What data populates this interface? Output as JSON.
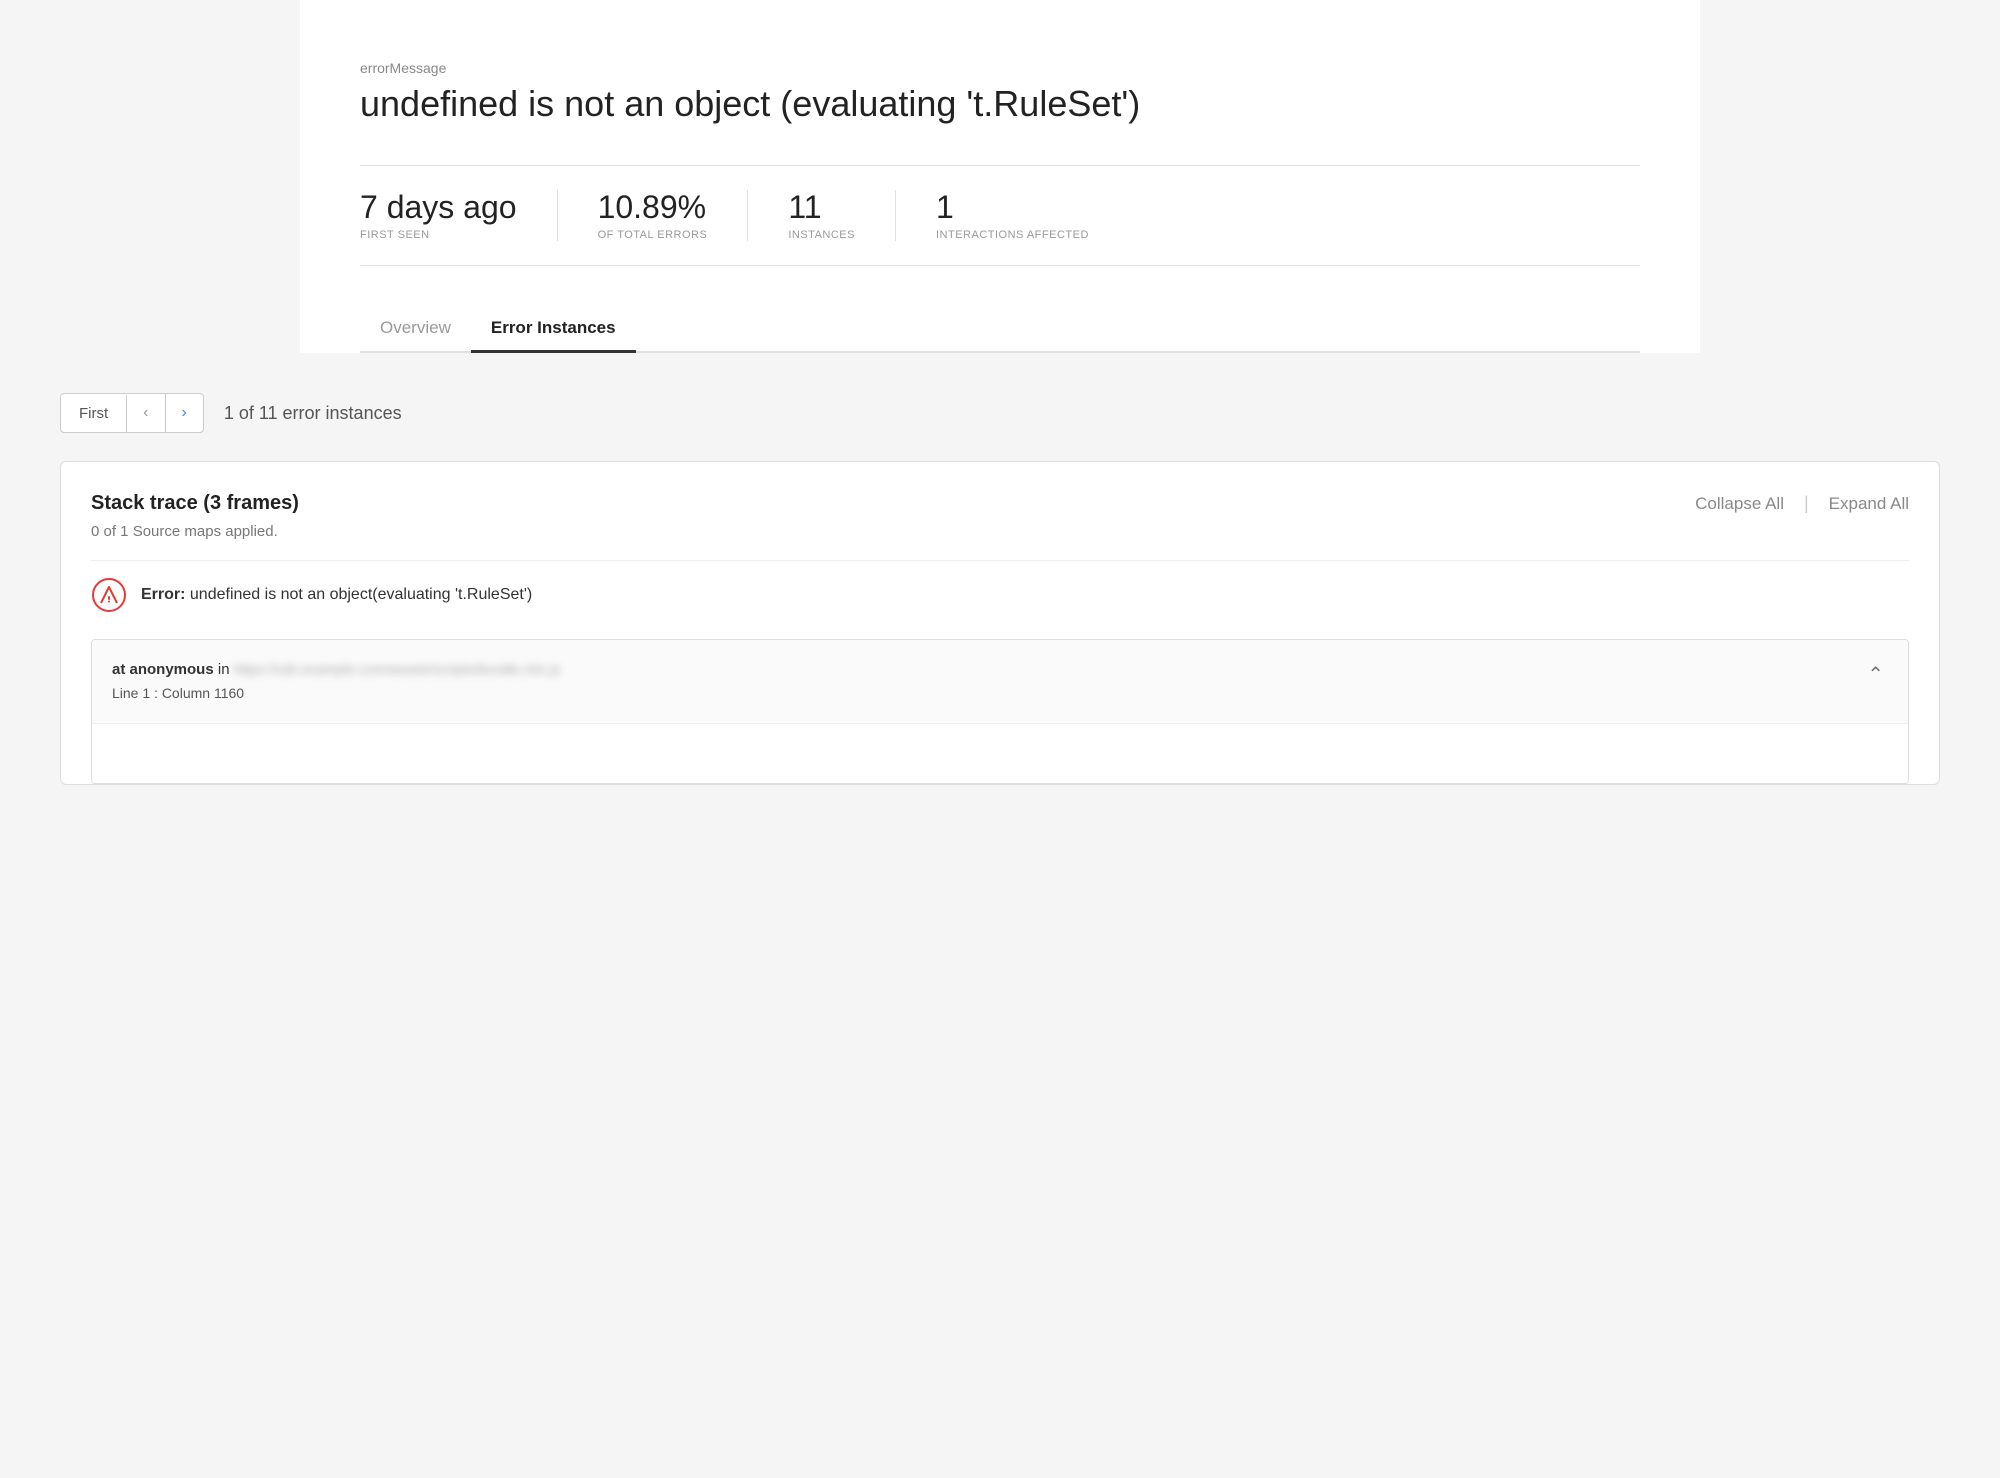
{
  "header": {
    "error_label": "errorMessage",
    "error_title": "undefined is not an object (evaluating 't.RuleSet')"
  },
  "stats": [
    {
      "value": "7 days ago",
      "label": "FIRST SEEN"
    },
    {
      "value": "10.89%",
      "label": "OF TOTAL ERRORS"
    },
    {
      "value": "11",
      "label": "INSTANCES"
    },
    {
      "value": "1",
      "label": "INTERACTIONS AFFECTED"
    }
  ],
  "tabs": [
    {
      "label": "Overview",
      "active": false
    },
    {
      "label": "Error Instances",
      "active": true
    }
  ],
  "instance_nav": {
    "first_label": "First",
    "prev_label": "‹",
    "next_label": "›",
    "count_text": "1 of 11 error instances"
  },
  "stack_trace": {
    "title": "Stack trace (3 frames)",
    "collapse_label": "Collapse All",
    "expand_label": "Expand All",
    "divider": "|",
    "source_maps": "0 of 1 Source maps applied.",
    "error_text_prefix": "Error:",
    "error_text_body": " undefined is not an object(evaluating 't.RuleSet')",
    "frame": {
      "func_label": "at anonymous",
      "in_label": "in",
      "url_placeholder": "https://cdn.example.com/assets/scripts/bundle.min.js",
      "line_col": "Line 1 : Column 1160"
    }
  },
  "colors": {
    "accent": "#333333",
    "tab_active_border": "#333333",
    "error_red": "#e53935",
    "nav_blue": "#3b82f6"
  }
}
